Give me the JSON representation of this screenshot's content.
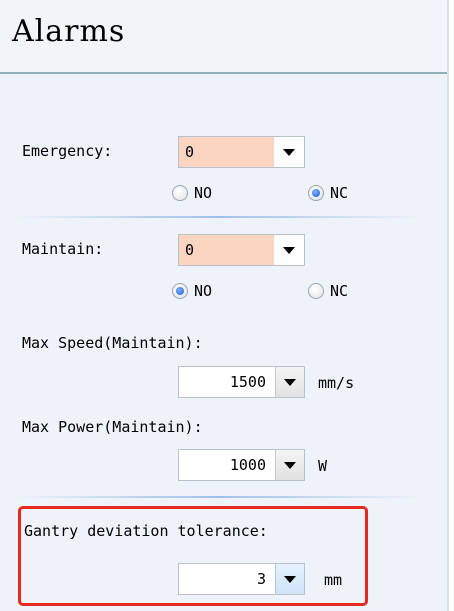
{
  "header": {
    "title": "Alarms"
  },
  "emergency": {
    "label": "Emergency:",
    "value": "0",
    "options": {
      "no": "NO",
      "nc": "NC"
    },
    "selected": "NC"
  },
  "maintain": {
    "label": "Maintain:",
    "value": "0",
    "options": {
      "no": "NO",
      "nc": "NC"
    },
    "selected": "NO"
  },
  "max_speed": {
    "label": "Max Speed(Maintain):",
    "value": "1500",
    "unit": "mm/s"
  },
  "max_power": {
    "label": "Max Power(Maintain):",
    "value": "1000",
    "unit": "W"
  },
  "gantry": {
    "label": "Gantry deviation tolerance:",
    "value": "3",
    "unit": "mm"
  },
  "colors": {
    "highlight": "#e52b1f",
    "select_bg": "#fbd3c1"
  },
  "icons": {
    "dropdown": "chevron-down-icon",
    "radio": "radio-icon"
  }
}
